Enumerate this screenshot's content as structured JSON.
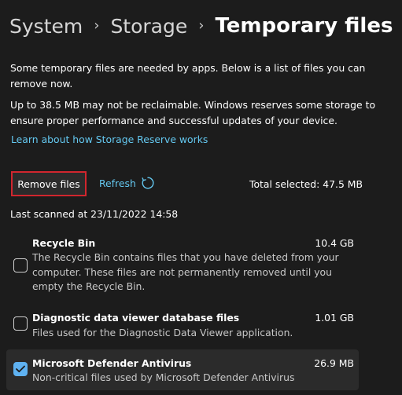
{
  "breadcrumb": {
    "items": [
      "System",
      "Storage"
    ],
    "current": "Temporary files",
    "separator": "›"
  },
  "intro": {
    "p1": "Some temporary files are needed by apps. Below is a list of files you can remove now.",
    "p2": "Up to 38.5 MB may not be reclaimable. Windows reserves some storage to ensure proper performance and successful updates of your device.",
    "learn_link": "Learn about how Storage Reserve works"
  },
  "actions": {
    "remove_label": "Remove files",
    "refresh_label": "Refresh",
    "refresh_icon": "refresh-icon",
    "total_selected": "Total selected: 47.5 MB"
  },
  "last_scanned": "Last scanned at 23/11/2022 14:58",
  "file_types": [
    {
      "title": "Recycle Bin",
      "size": "10.4 GB",
      "description": "The Recycle Bin contains files that you have deleted from your computer. These files are not permanently removed until you empty the Recycle Bin.",
      "checked": false
    },
    {
      "title": "Diagnostic data viewer database files",
      "size": "1.01 GB",
      "description": "Files used for the Diagnostic Data Viewer application.",
      "checked": false
    },
    {
      "title": "Microsoft Defender Antivirus",
      "size": "26.9 MB",
      "description": "Non-critical files used by Microsoft Defender Antivirus",
      "checked": true
    }
  ],
  "colors": {
    "background": "#1c1c1c",
    "accent_link": "#64c8f0",
    "checkbox_checked": "#5fb2f2",
    "highlight_border": "#d1262e"
  }
}
